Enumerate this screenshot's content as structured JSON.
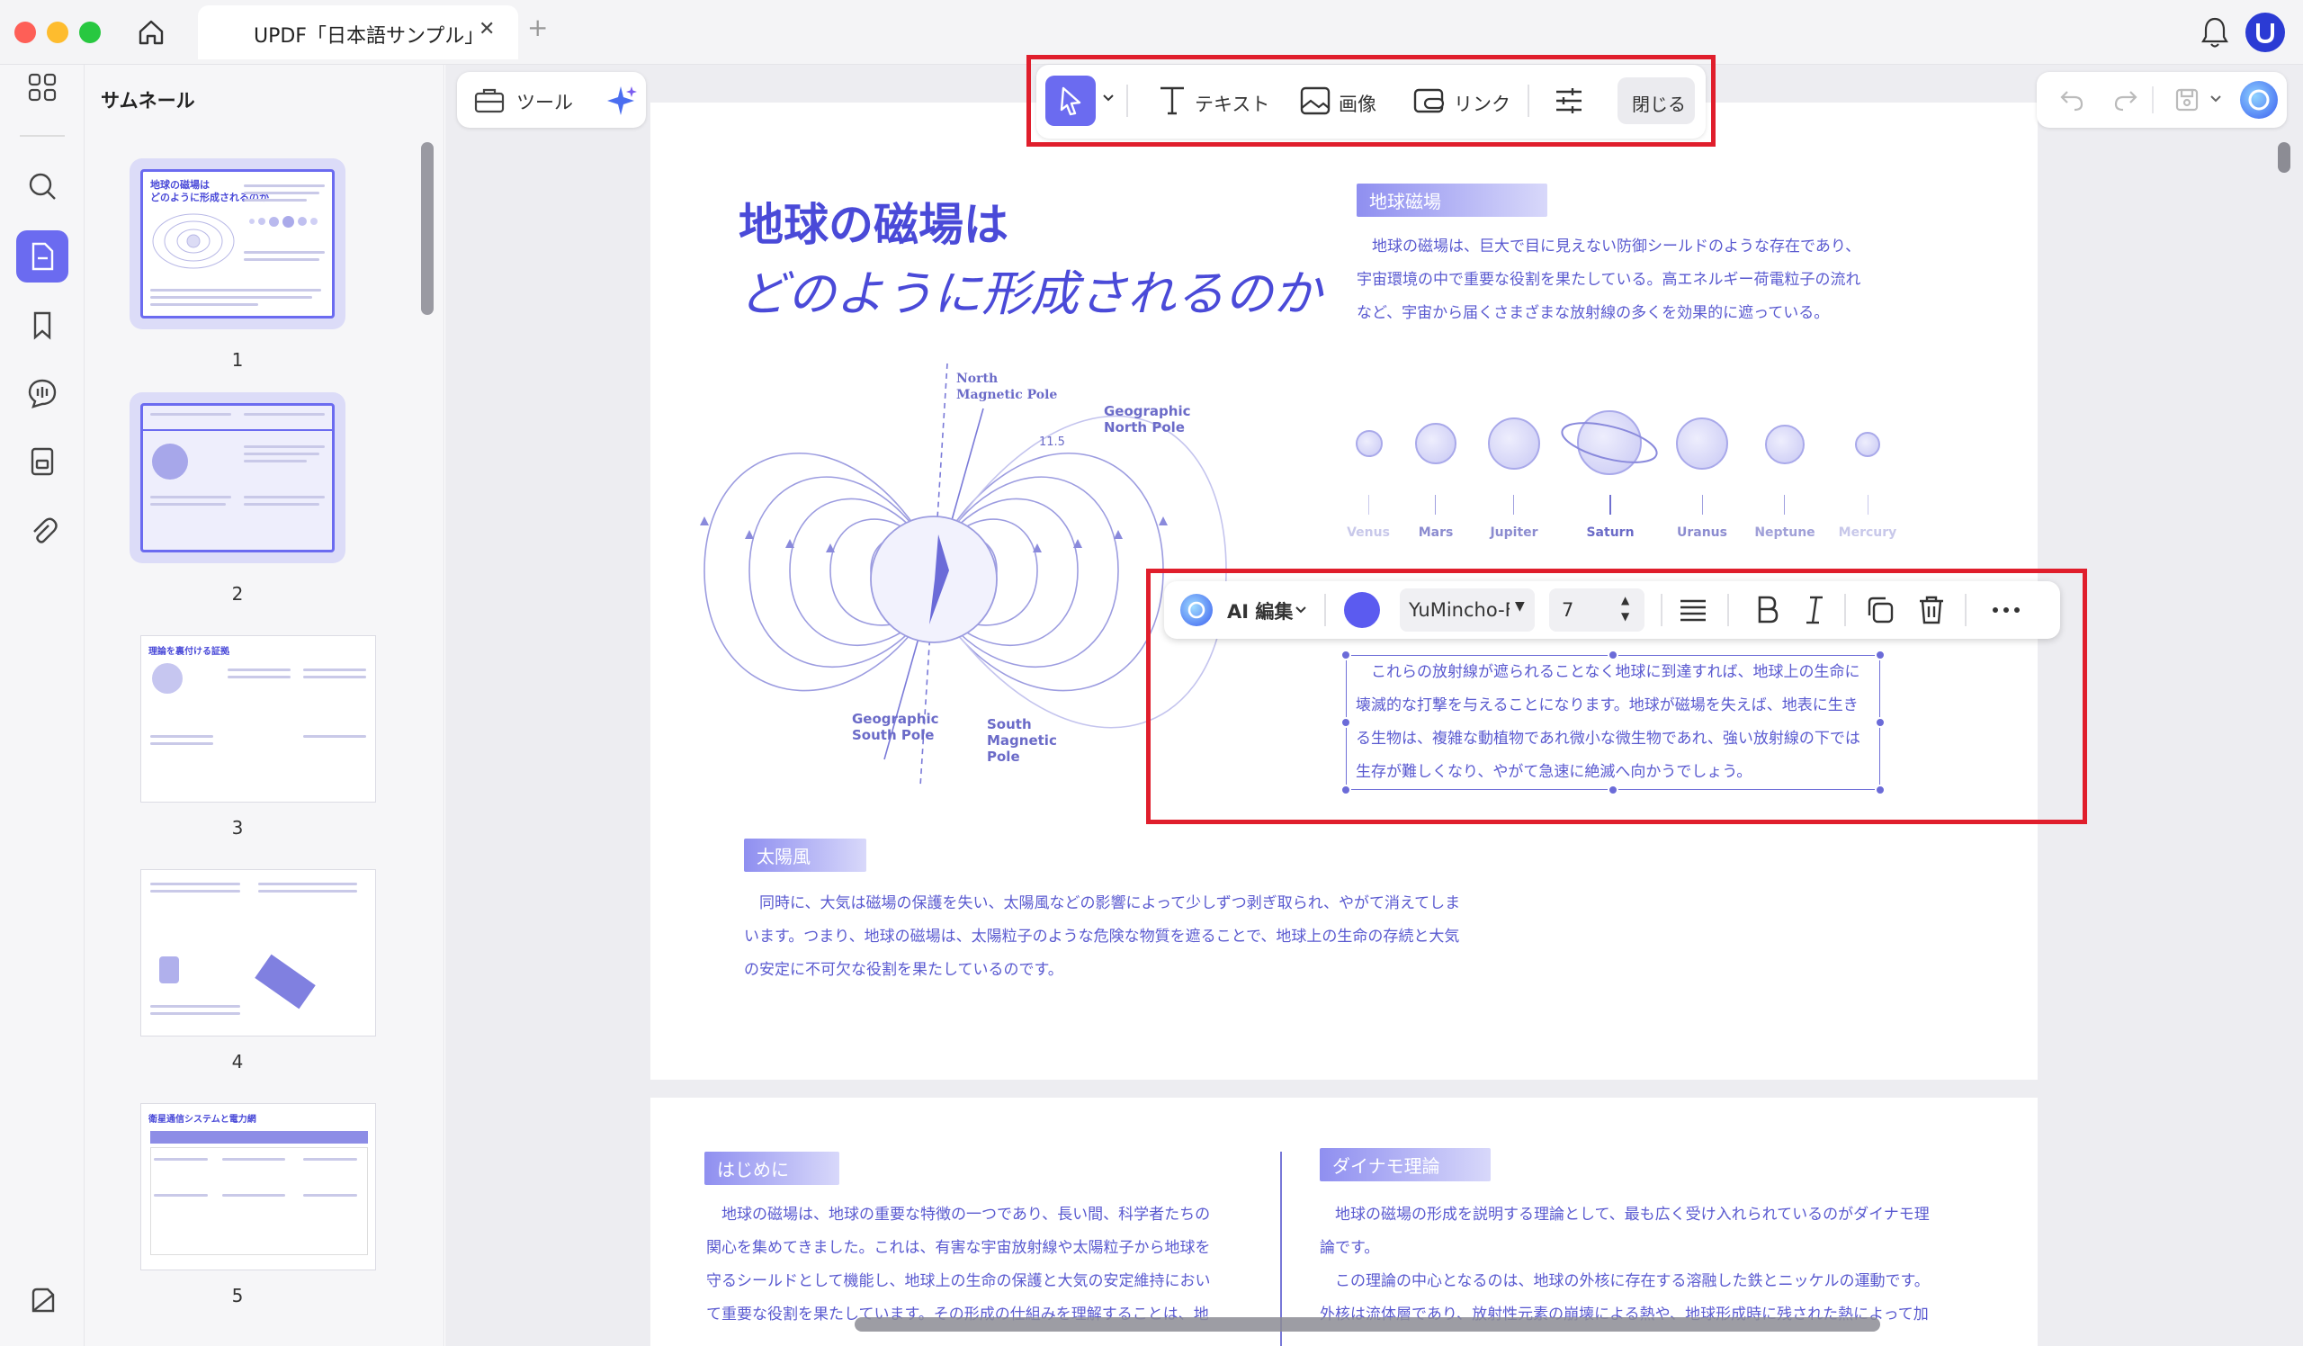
{
  "window": {
    "tab_title": "UPDF「日本語サンプル」",
    "close_tab": "✕",
    "new_tab": "+"
  },
  "sidebar": {
    "panel_title": "サムネール",
    "rail_icons": [
      "grid-icon",
      "search-icon",
      "document-icon",
      "bookmark-icon",
      "comment-icon",
      "page-icon",
      "attachment-icon",
      "layers-icon"
    ],
    "thumbnails": [
      {
        "number": "1",
        "title": "地球の磁場は\nどのように形成されるのか",
        "selected": true
      },
      {
        "number": "2",
        "selected": true
      },
      {
        "number": "3",
        "title": "理論を裏付ける証拠",
        "selected": false
      },
      {
        "number": "4",
        "selected": false
      },
      {
        "number": "5",
        "title": "衛星通信システムと電力網",
        "selected": false
      }
    ]
  },
  "tools": {
    "tools_label": "ツール"
  },
  "edit_toolbar": {
    "text_label": "テキスト",
    "image_label": "画像",
    "link_label": "リンク",
    "close_label": "閉じる"
  },
  "text_toolbar": {
    "ai_label": "AI 編集",
    "color": "#5b5bf0",
    "font_name": "YuMincho-F",
    "font_size": "7"
  },
  "colors": {
    "accent": "#6b6bf0",
    "highlight_red": "#e01e2c",
    "text_purple": "#4a4ad8"
  },
  "page1": {
    "title_line1": "地球の磁場は",
    "title_line2": "どのように形成されるのか",
    "section1_head": "地球磁場",
    "section1_lines": [
      "地球の磁場は、巨大で目に見えない防御シールドのような存在であり、",
      "宇宙環境の中で重要な役割を果たしている。高エネルギー荷電粒子の流れ",
      "など、宇宙から届くさまざまな放射線の多くを効果的に遮っている。"
    ],
    "diagram_labels": {
      "north_magnetic": "North\nMagnetic Pole",
      "geographic_north": "Geographic\nNorth Pole",
      "angle": "11.5",
      "geographic_south": "Geographic\nSouth Pole",
      "south_magnetic": "South\nMagnetic\nPole"
    },
    "planets": [
      "Venus",
      "Mars",
      "Jupiter",
      "Saturn",
      "Uranus",
      "Neptune",
      "Mercury"
    ],
    "selected_lines": [
      "これらの放射線が遮られることなく地球に到達すれば、地球上の生命に",
      "壊滅的な打撃を与えることになります。地球が磁場を失えば、地表に生き",
      "る生物は、複雑な動植物であれ微小な微生物であれ、強い放射線の下では",
      "生存が難しくなり、やがて急速に絶滅へ向かうでしょう。"
    ],
    "section2_head": "太陽風",
    "section2_lines": [
      "同時に、大気は磁場の保護を失い、太陽風などの影響によって少しずつ剥ぎ取られ、やがて消えてしま",
      "います。つまり、地球の磁場は、太陽粒子のような危険な物質を遮ることで、地球上の生命の存続と大気",
      "の安定に不可欠な役割を果たしているのです。"
    ]
  },
  "page2": {
    "left_head": "はじめに",
    "left_lines": [
      "地球の磁場は、地球の重要な特徴の一つであり、長い間、科学者たちの",
      "関心を集めてきました。これは、有害な宇宙放射線や太陽粒子から地球を",
      "守るシールドとして機能し、地球上の生命の保護と大気の安定維持におい",
      "て重要な役割を果たしています。その形成の仕組みを理解することは、地"
    ],
    "right_head": "ダイナモ理論",
    "right_lines": [
      "地球の磁場の形成を説明する理論として、最も広く受け入れられているのがダイナモ理",
      "論です。",
      "この理論の中心となるのは、地球の外核に存在する溶融した鉄とニッケルの運動です。",
      "外核は流体層であり、放射性元素の崩壊による熱や、地球形成時に残された熱によって加"
    ]
  }
}
